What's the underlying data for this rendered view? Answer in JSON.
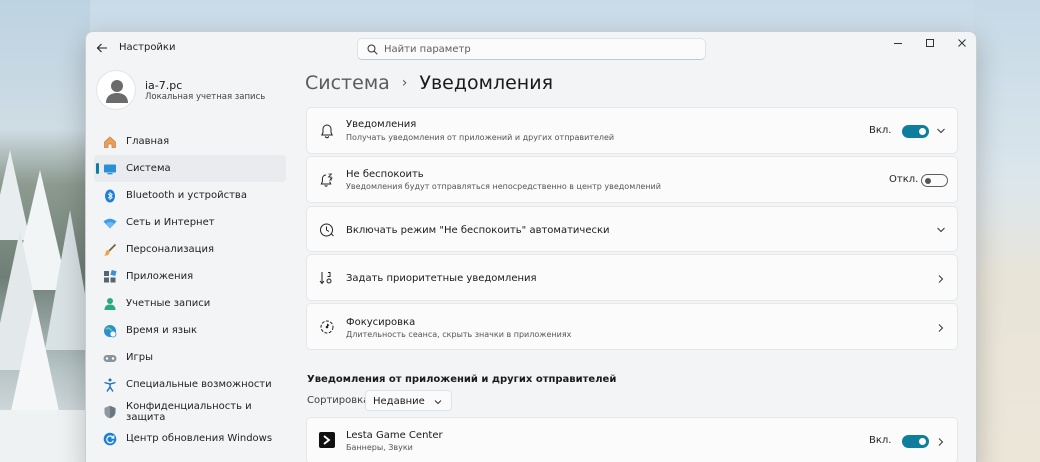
{
  "app": {
    "title": "Настройки",
    "back_icon": "back-arrow-icon"
  },
  "search": {
    "placeholder": "Найти параметр",
    "value": ""
  },
  "window_controls": {
    "minimize": "minimize-icon",
    "maximize": "maximize-icon",
    "close": "close-icon"
  },
  "user": {
    "name": "ia-7.pc",
    "account_type": "Локальная учетная запись"
  },
  "sidebar": {
    "items": [
      {
        "label": "Главная",
        "icon": "home-icon",
        "active": false
      },
      {
        "label": "Система",
        "icon": "system-icon",
        "active": true
      },
      {
        "label": "Bluetooth и устройства",
        "icon": "bluetooth-icon",
        "active": false
      },
      {
        "label": "Сеть и Интернет",
        "icon": "network-icon",
        "active": false
      },
      {
        "label": "Персонализация",
        "icon": "brush-icon",
        "active": false
      },
      {
        "label": "Приложения",
        "icon": "apps-icon",
        "active": false
      },
      {
        "label": "Учетные записи",
        "icon": "accounts-icon",
        "active": false
      },
      {
        "label": "Время и язык",
        "icon": "globe-clock-icon",
        "active": false
      },
      {
        "label": "Игры",
        "icon": "gamepad-icon",
        "active": false
      },
      {
        "label": "Специальные возможности",
        "icon": "accessibility-icon",
        "active": false
      },
      {
        "label": "Конфиденциальность и защита",
        "icon": "shield-icon",
        "active": false
      },
      {
        "label": "Центр обновления Windows",
        "icon": "update-icon",
        "active": false
      }
    ]
  },
  "breadcrumb": {
    "parent": "Система",
    "separator": "›",
    "current": "Уведомления"
  },
  "cards": {
    "notifications": {
      "title": "Уведомления",
      "subtitle": "Получать уведомления от приложений и других отправителей",
      "state_label": "Вкл.",
      "enabled": true,
      "icon": "bell-icon"
    },
    "dnd": {
      "title": "Не беспокоить",
      "subtitle": "Уведомления будут отправляться непосредственно в центр уведомлений",
      "state_label": "Откл.",
      "enabled": false,
      "icon": "bell-zz-icon"
    },
    "auto_dnd": {
      "title": "Включать режим \"Не беспокоить\" автоматически",
      "icon": "clock-icon"
    },
    "priority": {
      "title": "Задать приоритетные уведомления",
      "icon": "priority-sort-icon"
    },
    "focus": {
      "title": "Фокусировка",
      "subtitle": "Длительность сеанса, скрыть значки в приложениях",
      "icon": "focus-icon"
    }
  },
  "apps_section": {
    "heading": "Уведомления от приложений и других отправителей",
    "sort_label": "Сортировка:",
    "sort_value": "Недавние",
    "apps": [
      {
        "name": "Lesta Game Center",
        "subtitle": "Баннеры, Звуки",
        "state_label": "Вкл.",
        "enabled": true,
        "icon": "lesta-logo-icon"
      }
    ]
  },
  "colors": {
    "accent": "#0f7d9c",
    "window_bg": "#f2f4f6",
    "card_bg": "#fbfbfb"
  }
}
